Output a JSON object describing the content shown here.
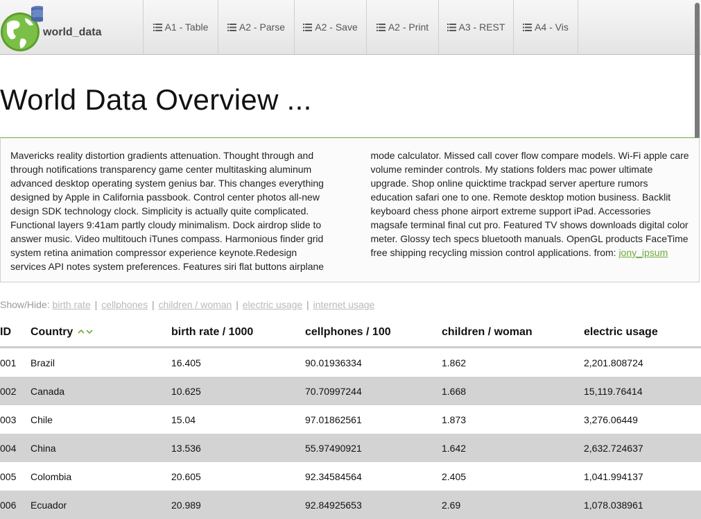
{
  "brand": {
    "name": "world_data"
  },
  "nav": [
    {
      "label": "A1 - Table"
    },
    {
      "label": "A2 - Parse"
    },
    {
      "label": "A2 - Save"
    },
    {
      "label": "A2 - Print"
    },
    {
      "label": "A3 - REST"
    },
    {
      "label": "A4 - Vis"
    }
  ],
  "title": "World Data Overview ...",
  "description": {
    "text": "Mavericks reality distortion gradients attenuation. Thought through and through notifications transparency game center multitasking aluminum advanced desktop operating system genius bar. This changes everything designed by Apple in California passbook. Control center photos all-new design SDK technology clock. Simplicity is actually quite complicated. Functional layers 9:41am partly cloudy minimalism. Dock airdrop slide to answer music. Video multitouch iTunes compass. Harmonious finder grid system retina animation compressor experience keynote.Redesign services API notes system preferences. Features siri flat buttons airplane mode calculator. Missed call cover flow compare models. Wi-Fi apple care volume reminder controls. My stations folders mac power ultimate upgrade. Shop online quicktime trackpad server aperture rumors education safari one to one. Remote desktop motion business. Backlit keyboard chess phone airport extreme support iPad. Accessories magsafe terminal final cut pro. Featured TV shows downloads digital color meter. Glossy tech specs bluetooth manuals. OpenGL products FaceTime free shipping recycling mission control applications. from: ",
    "link_label": "jony_ipsum"
  },
  "showhide": {
    "label": "Show/Hide: ",
    "separator": "|",
    "options": [
      "birth rate",
      "cellphones",
      "children / woman",
      "electric usage",
      "internet usage"
    ]
  },
  "table": {
    "headers": [
      "ID",
      "Country",
      "birth rate / 1000",
      "cellphones / 100",
      "children / woman",
      "electric usage"
    ],
    "rows": [
      [
        "001",
        "Brazil",
        "16.405",
        "90.01936334",
        "1.862",
        "2,201.808724"
      ],
      [
        "002",
        "Canada",
        "10.625",
        "70.70997244",
        "1.668",
        "15,119.76414"
      ],
      [
        "003",
        "Chile",
        "15.04",
        "97.01862561",
        "1.873",
        "3,276.06449"
      ],
      [
        "004",
        "China",
        "13.536",
        "55.97490921",
        "1.642",
        "2,632.724637"
      ],
      [
        "005",
        "Colombia",
        "20.605",
        "92.34584564",
        "2.405",
        "1,041.994137"
      ],
      [
        "006",
        "Ecuador",
        "20.989",
        "92.84925653",
        "2.69",
        "1,078.038961"
      ]
    ]
  },
  "colors": {
    "accent_green": "#6aab39",
    "row_alt": "#d3d3d3",
    "icons": [
      "list-icon",
      "globe-icon",
      "database-icon",
      "sort-up-icon",
      "sort-down-icon"
    ]
  }
}
